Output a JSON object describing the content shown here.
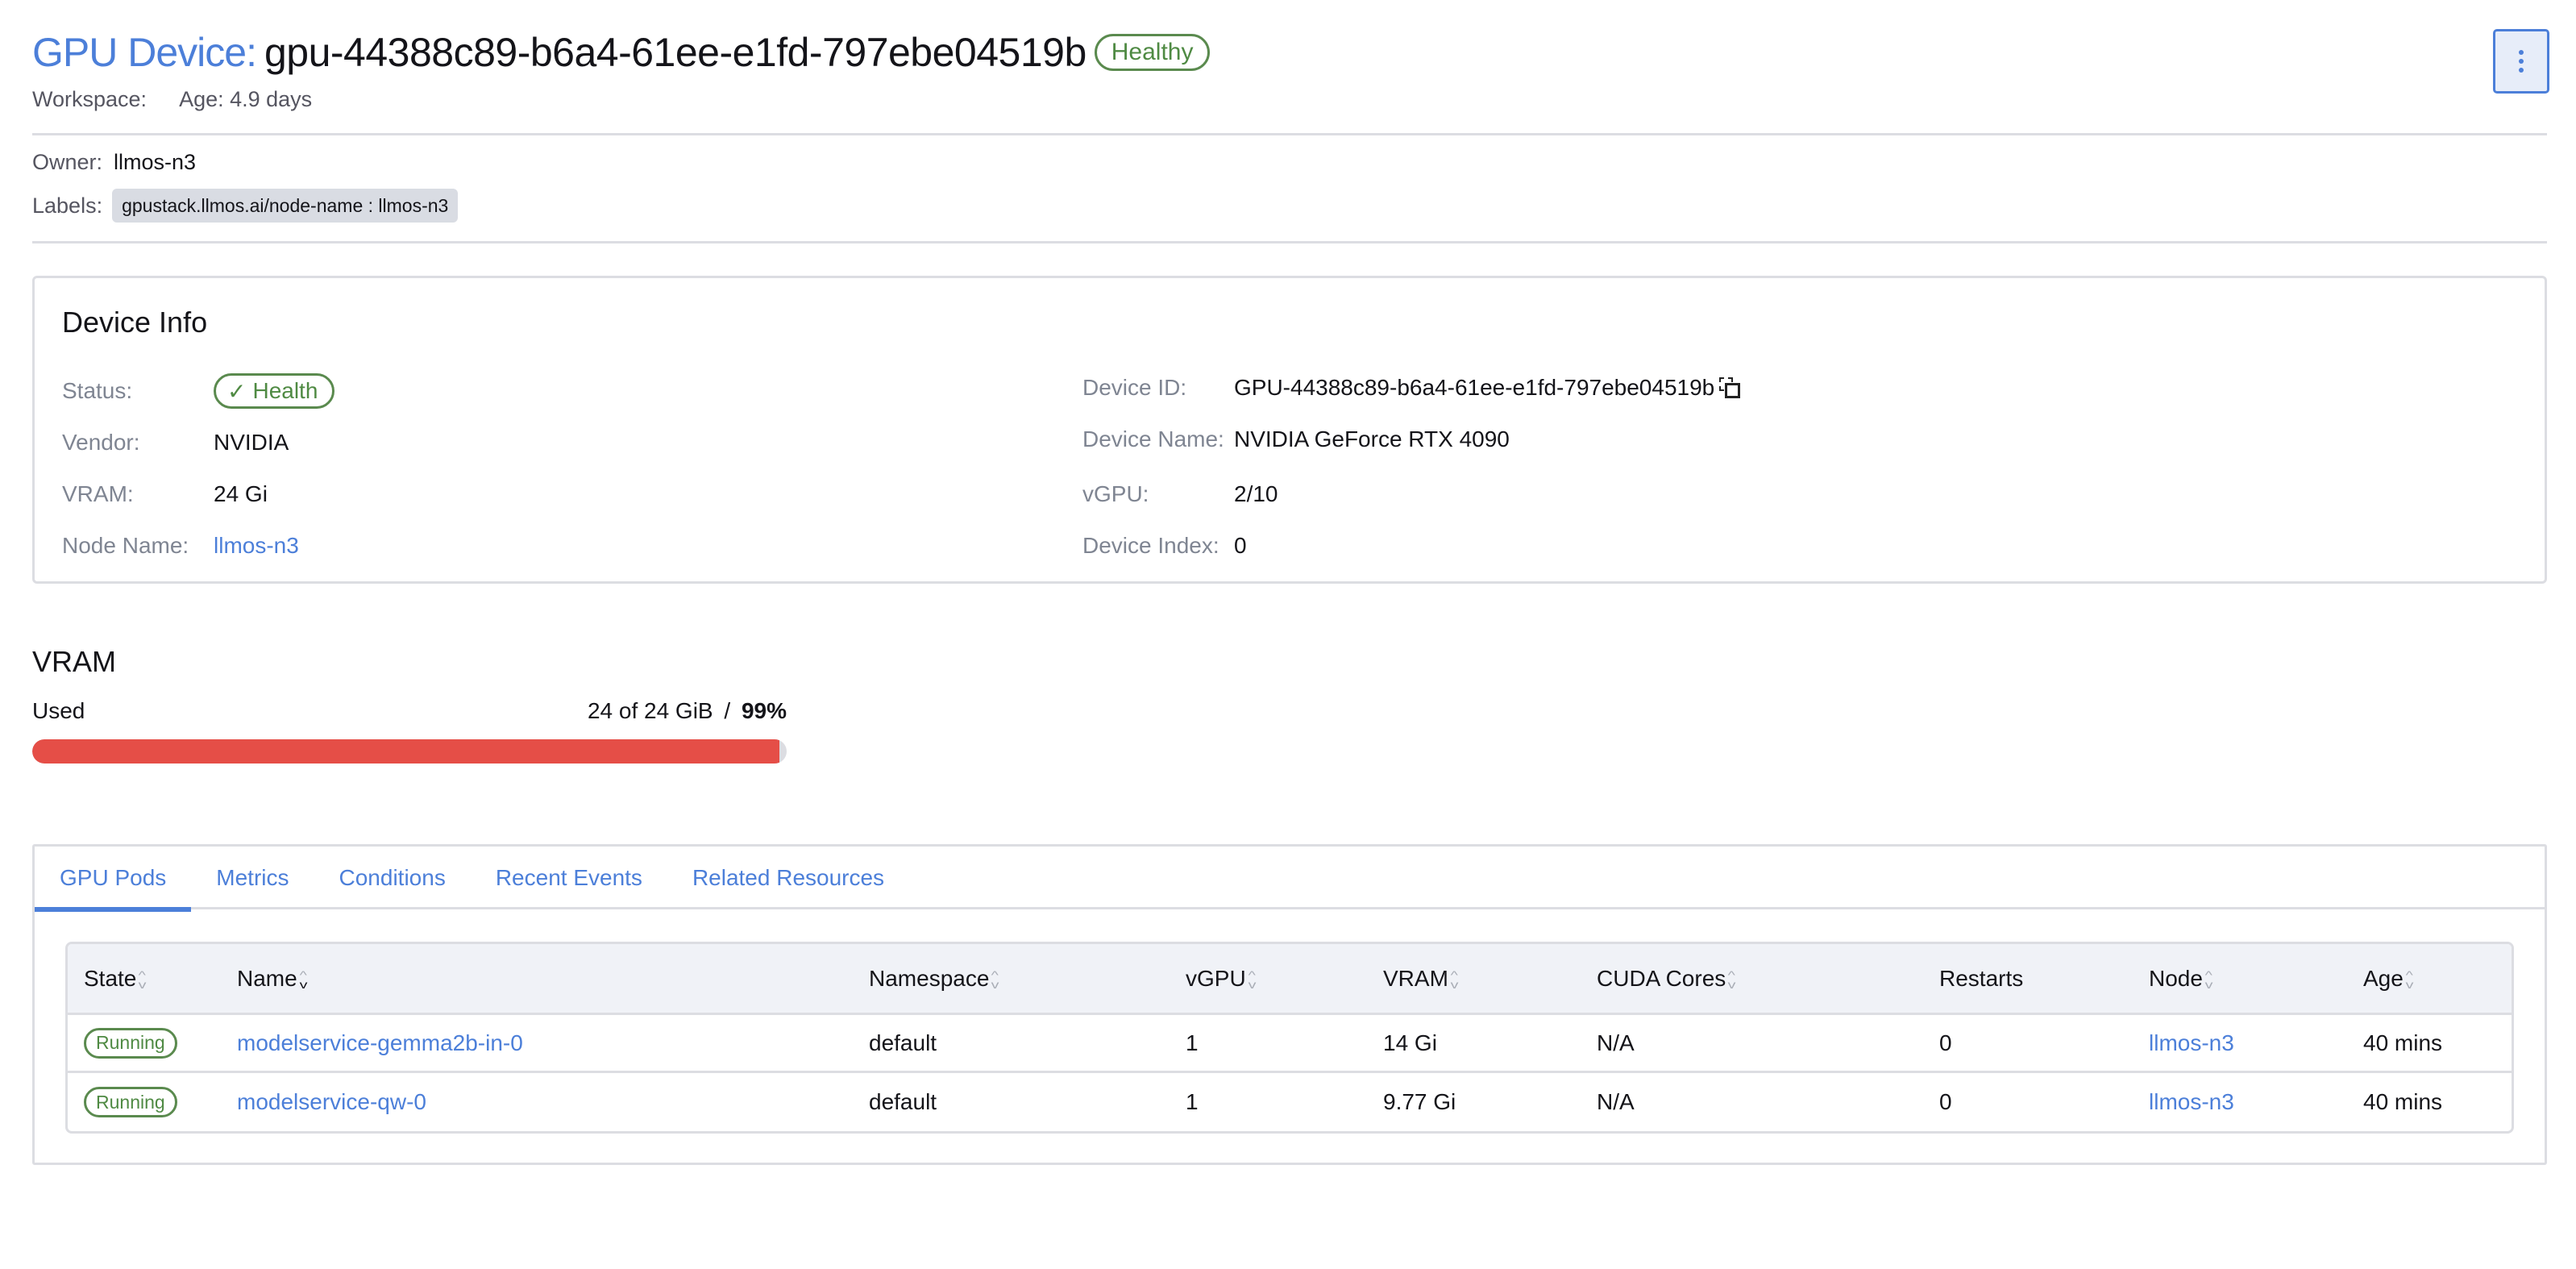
{
  "header": {
    "title_prefix": "GPU Device:",
    "title_name": "gpu-44388c89-b6a4-61ee-e1fd-797ebe04519b",
    "health_badge": "Healthy",
    "workspace_label": "Workspace:",
    "age_label": "Age: 4.9 days",
    "menu_icon": "more-vertical-icon"
  },
  "owner": {
    "label": "Owner:",
    "value": "llmos-n3"
  },
  "labels": {
    "label": "Labels:",
    "chips": [
      "gpustack.llmos.ai/node-name : llmos-n3"
    ]
  },
  "device_info": {
    "title": "Device Info",
    "left": [
      {
        "label": "Status:",
        "value": "Health",
        "type": "status"
      },
      {
        "label": "Vendor:",
        "value": "NVIDIA"
      },
      {
        "label": "VRAM:",
        "value": "24 Gi"
      },
      {
        "label": "Node Name:",
        "value": "llmos-n3",
        "type": "link"
      }
    ],
    "right": [
      {
        "label": "Device ID:",
        "value": "GPU-44388c89-b6a4-61ee-e1fd-797ebe04519b",
        "type": "copy"
      },
      {
        "label": "Device Name:",
        "value": "NVIDIA GeForce RTX 4090"
      },
      {
        "label": "vGPU:",
        "value": "2/10"
      },
      {
        "label": "Device Index:",
        "value": "0"
      }
    ]
  },
  "vram": {
    "title": "VRAM",
    "used_label": "Used",
    "amount": "24 of 24 GiB",
    "separator": "/",
    "percent_label": "99%",
    "percent": 99,
    "fill_color": "#e54e47"
  },
  "tabs": [
    {
      "label": "GPU Pods",
      "active": true
    },
    {
      "label": "Metrics"
    },
    {
      "label": "Conditions"
    },
    {
      "label": "Recent Events"
    },
    {
      "label": "Related Resources"
    }
  ],
  "pods_table": {
    "columns": [
      {
        "label": "State",
        "sortable": true
      },
      {
        "label": "Name",
        "sortable": true,
        "sorted": "desc"
      },
      {
        "label": "Namespace",
        "sortable": true
      },
      {
        "label": "vGPU",
        "sortable": true
      },
      {
        "label": "VRAM",
        "sortable": true
      },
      {
        "label": "CUDA Cores",
        "sortable": true
      },
      {
        "label": "Restarts",
        "sortable": false
      },
      {
        "label": "Node",
        "sortable": true
      },
      {
        "label": "Age",
        "sortable": true
      }
    ],
    "rows": [
      {
        "state": "Running",
        "name": "modelservice-gemma2b-in-0",
        "namespace": "default",
        "vgpu": "1",
        "vram": "14 Gi",
        "cuda_cores": "N/A",
        "restarts": "0",
        "node": "llmos-n3",
        "age": "40 mins"
      },
      {
        "state": "Running",
        "name": "modelservice-qw-0",
        "namespace": "default",
        "vgpu": "1",
        "vram": "9.77 Gi",
        "cuda_cores": "N/A",
        "restarts": "0",
        "node": "llmos-n3",
        "age": "40 mins"
      }
    ]
  },
  "colors": {
    "accent": "#4c7fd9",
    "healthy": "#4f8a43",
    "danger": "#e54e47"
  }
}
